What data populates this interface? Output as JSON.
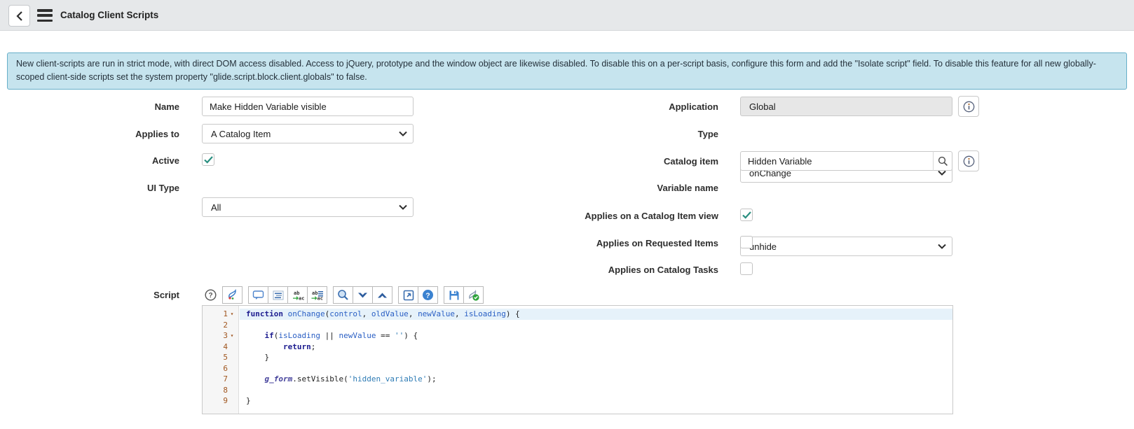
{
  "header": {
    "title": "Catalog Client Scripts"
  },
  "banner": {
    "text": "New client-scripts are run in strict mode, with direct DOM access disabled. Access to jQuery, prototype and the window object are likewise disabled. To disable this on a per-script basis, configure this form and add the \"Isolate script\" field. To disable this feature for all new globally-scoped client-side scripts set the system property \"glide.script.block.client.globals\" to false."
  },
  "fields": {
    "name": {
      "label": "Name",
      "value": "Make Hidden Variable visible"
    },
    "applies_to": {
      "label": "Applies to",
      "value": "A Catalog Item"
    },
    "active": {
      "label": "Active",
      "checked": true
    },
    "ui_type": {
      "label": "UI Type",
      "value": "All"
    },
    "application": {
      "label": "Application",
      "value": "Global"
    },
    "type": {
      "label": "Type",
      "value": "onChange"
    },
    "catalog_item": {
      "label": "Catalog item",
      "value": "Hidden Variable"
    },
    "variable_name": {
      "label": "Variable name",
      "value": "unhide"
    },
    "applies_catalog_item_view": {
      "label": "Applies on a Catalog Item view",
      "checked": true
    },
    "applies_requested_items": {
      "label": "Applies on Requested Items",
      "checked": false
    },
    "applies_catalog_tasks": {
      "label": "Applies on Catalog Tasks",
      "checked": false
    },
    "script": {
      "label": "Script"
    }
  },
  "toolbar": {
    "icons": [
      "help-circle",
      "toggle-syntax-editor",
      "toggle-comment",
      "format-code",
      "replace",
      "replace-all",
      "search",
      "find-next",
      "find-previous",
      "expand-editor",
      "editor-help",
      "save",
      "syntax-check"
    ]
  },
  "script_editor": {
    "lines": [
      {
        "num": 1,
        "fold": true,
        "active": true,
        "tokens": [
          {
            "t": "kw",
            "v": "function"
          },
          {
            "t": "pl",
            "v": " "
          },
          {
            "t": "fn",
            "v": "onChange"
          },
          {
            "t": "pl",
            "v": "("
          },
          {
            "t": "vr",
            "v": "control"
          },
          {
            "t": "pl",
            "v": ", "
          },
          {
            "t": "vr",
            "v": "oldValue"
          },
          {
            "t": "pl",
            "v": ", "
          },
          {
            "t": "vr",
            "v": "newValue"
          },
          {
            "t": "pl",
            "v": ", "
          },
          {
            "t": "vr",
            "v": "isLoading"
          },
          {
            "t": "pl",
            "v": ") {"
          }
        ]
      },
      {
        "num": 2,
        "fold": false,
        "active": false,
        "tokens": []
      },
      {
        "num": 3,
        "fold": true,
        "active": false,
        "tokens": [
          {
            "t": "pl",
            "v": "    "
          },
          {
            "t": "kw",
            "v": "if"
          },
          {
            "t": "pl",
            "v": "("
          },
          {
            "t": "vr",
            "v": "isLoading"
          },
          {
            "t": "pl",
            "v": " "
          },
          {
            "t": "op",
            "v": "||"
          },
          {
            "t": "pl",
            "v": " "
          },
          {
            "t": "vr",
            "v": "newValue"
          },
          {
            "t": "pl",
            "v": " "
          },
          {
            "t": "op",
            "v": "=="
          },
          {
            "t": "pl",
            "v": " "
          },
          {
            "t": "st",
            "v": "''"
          },
          {
            "t": "pl",
            "v": ") {"
          }
        ]
      },
      {
        "num": 4,
        "fold": false,
        "active": false,
        "tokens": [
          {
            "t": "pl",
            "v": "        "
          },
          {
            "t": "kw",
            "v": "return"
          },
          {
            "t": "pl",
            "v": ";"
          }
        ]
      },
      {
        "num": 5,
        "fold": false,
        "active": false,
        "tokens": [
          {
            "t": "pl",
            "v": "    }"
          }
        ]
      },
      {
        "num": 6,
        "fold": false,
        "active": false,
        "tokens": []
      },
      {
        "num": 7,
        "fold": false,
        "active": false,
        "tokens": [
          {
            "t": "pl",
            "v": "    "
          },
          {
            "t": "gf",
            "v": "g_form"
          },
          {
            "t": "pl",
            "v": ".setVisible("
          },
          {
            "t": "st",
            "v": "'hidden_variable'"
          },
          {
            "t": "pl",
            "v": ");"
          }
        ]
      },
      {
        "num": 8,
        "fold": false,
        "active": false,
        "tokens": []
      },
      {
        "num": 9,
        "fold": false,
        "active": false,
        "tokens": [
          {
            "t": "pl",
            "v": "}"
          }
        ]
      }
    ]
  },
  "colors": {
    "accent_blue": "#3b7ec9",
    "check_teal": "#2a8f80",
    "banner_bg": "#c6e4ee",
    "banner_border": "#67afc9",
    "header_bg": "#e6e8ea"
  }
}
